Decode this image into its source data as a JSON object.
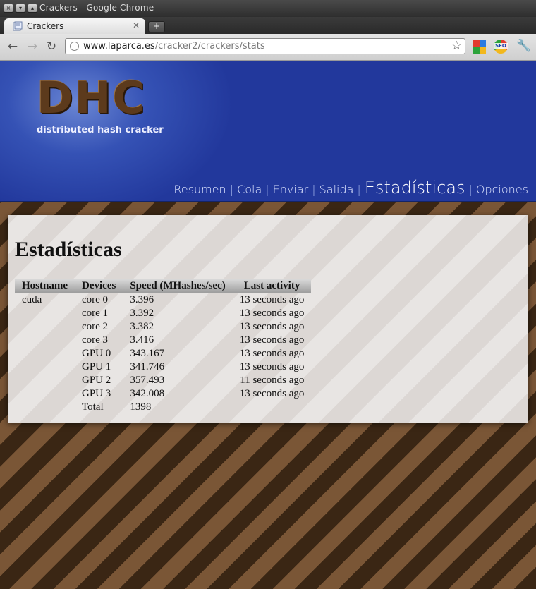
{
  "window": {
    "title": "Crackers - Google Chrome"
  },
  "tab": {
    "label": "Crackers"
  },
  "toolbar": {
    "url_host": "www.laparca.es",
    "url_path": "/cracker2/crackers/stats",
    "extension_seo_label": "SEO"
  },
  "header": {
    "logo": "DHC",
    "tagline": "distributed hash cracker",
    "nav": [
      {
        "label": "Resumen"
      },
      {
        "label": "Cola"
      },
      {
        "label": "Enviar"
      },
      {
        "label": "Salida"
      },
      {
        "label": "Estadísticas",
        "active": true
      },
      {
        "label": "Opciones"
      }
    ]
  },
  "main": {
    "heading": "Estadísticas",
    "table": {
      "columns": [
        "Hostname",
        "Devices",
        "Speed (MHashes/sec)",
        "Last activity"
      ],
      "rows": [
        [
          "cuda",
          "core 0",
          "3.396",
          "13 seconds ago"
        ],
        [
          "",
          "core 1",
          "3.392",
          "13 seconds ago"
        ],
        [
          "",
          "core 2",
          "3.382",
          "13 seconds ago"
        ],
        [
          "",
          "core 3",
          "3.416",
          "13 seconds ago"
        ],
        [
          "",
          "GPU 0",
          "343.167",
          "13 seconds ago"
        ],
        [
          "",
          "GPU 1",
          "341.746",
          "13 seconds ago"
        ],
        [
          "",
          "GPU 2",
          "357.493",
          "11 seconds ago"
        ],
        [
          "",
          "GPU 3",
          "342.008",
          "13 seconds ago"
        ],
        [
          "",
          "Total",
          "1398",
          ""
        ]
      ]
    }
  },
  "colors": {
    "header_blue": "#22389c",
    "stripe_dark": "#3a2614",
    "stripe_light": "#7a5636"
  }
}
